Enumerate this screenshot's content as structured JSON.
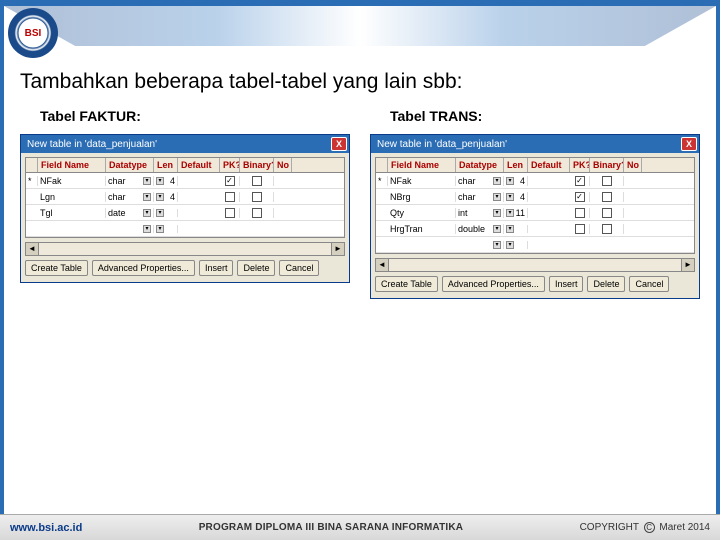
{
  "heading": "Tambahkan beberapa tabel-tabel yang lain sbb:",
  "leftTable": {
    "title": "Tabel FAKTUR:",
    "windowTitle": "New table in 'data_penjualan'",
    "columns": {
      "field": "Field Name",
      "datatype": "Datatype",
      "len": "Len",
      "def": "Default",
      "pk": "PK?",
      "bin": "Binary?",
      "no": "No"
    },
    "rows": [
      {
        "marker": "*",
        "name": "NFak",
        "type": "char",
        "len": "4",
        "pk": true
      },
      {
        "marker": "",
        "name": "Lgn",
        "type": "char",
        "len": "4",
        "pk": false
      },
      {
        "marker": "",
        "name": "Tgl",
        "type": "date",
        "len": "",
        "pk": false
      },
      {
        "marker": "",
        "name": "",
        "type": "",
        "len": "",
        "pk": null
      }
    ]
  },
  "rightTable": {
    "title": "Tabel TRANS:",
    "windowTitle": "New table in 'data_penjualan'",
    "columns": {
      "field": "Field Name",
      "datatype": "Datatype",
      "len": "Len",
      "def": "Default",
      "pk": "PK?",
      "bin": "Binary?",
      "no": "No"
    },
    "rows": [
      {
        "marker": "*",
        "name": "NFak",
        "type": "char",
        "len": "4",
        "pk": true
      },
      {
        "marker": "",
        "name": "NBrg",
        "type": "char",
        "len": "4",
        "pk": true
      },
      {
        "marker": "",
        "name": "Qty",
        "type": "int",
        "len": "11",
        "pk": false
      },
      {
        "marker": "",
        "name": "HrgTran",
        "type": "double",
        "len": "",
        "pk": false
      },
      {
        "marker": "",
        "name": "",
        "type": "",
        "len": "",
        "pk": null
      }
    ]
  },
  "buttons": {
    "create": "Create Table",
    "adv": "Advanced Properties...",
    "insert": "Insert",
    "delete": "Delete",
    "cancel": "Cancel"
  },
  "footer": {
    "url": "www.bsi.ac.id",
    "mid": "PROGRAM DIPLOMA III BINA SARANA INFORMATIKA",
    "right_a": "COPYRIGHT",
    "right_b": "Maret 2014"
  },
  "icons": {
    "close": "X",
    "dd": "▾",
    "chk": "✓",
    "left": "◄",
    "right": "►"
  }
}
